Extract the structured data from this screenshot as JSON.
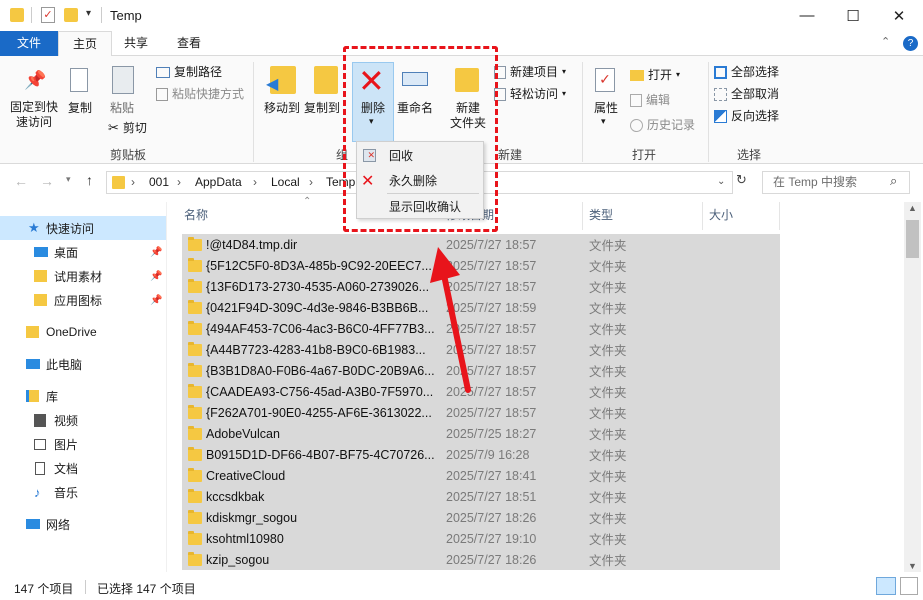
{
  "window": {
    "title": "Temp",
    "minimize": "—",
    "maximize": "☐",
    "close": "✕"
  },
  "ribbon_tabs": [
    "文件",
    "主页",
    "共享",
    "查看"
  ],
  "clipboard": {
    "pin": "固定到快\n速访问",
    "copy": "复制",
    "paste": "粘贴",
    "copy_path": "复制路径",
    "paste_shortcut": "粘贴快捷方式",
    "cut": "剪切",
    "group": "剪贴板"
  },
  "organize": {
    "move_to": "移动到",
    "copy_to": "复制到",
    "delete": "删除",
    "rename": "重命名",
    "group": "组织"
  },
  "new": {
    "new_folder": "新建\n文件夹",
    "new_item": "新建项目",
    "easy_access": "轻松访问",
    "group": "新建"
  },
  "open": {
    "properties": "属性",
    "open": "打开",
    "edit": "编辑",
    "history": "历史记录",
    "group": "打开"
  },
  "select": {
    "select_all": "全部选择",
    "select_none": "全部取消",
    "invert": "反向选择",
    "group": "选择"
  },
  "delete_menu": {
    "recycle": "回收",
    "permanent": "永久删除",
    "show_confirm": "显示回收确认"
  },
  "address": {
    "crumbs": [
      "001",
      "AppData",
      "Local",
      "Temp"
    ],
    "search_placeholder": "在 Temp 中搜索"
  },
  "sidebar": {
    "quick_access": "快速访问",
    "items": [
      "桌面",
      "试用素材",
      "应用图标"
    ],
    "onedrive": "OneDrive",
    "this_pc": "此电脑",
    "libraries": "库",
    "lib_items": [
      "视频",
      "图片",
      "文档",
      "音乐"
    ],
    "network": "网络"
  },
  "columns": {
    "name": "名称",
    "date": "修改日期",
    "type": "类型",
    "size": "大小"
  },
  "files": [
    {
      "name": "!@t4D84.tmp.dir",
      "date": "2025/7/27 18:57",
      "type": "文件夹"
    },
    {
      "name": "{5F12C5F0-8D3A-485b-9C92-20EEC7...",
      "date": "2025/7/27 18:57",
      "type": "文件夹"
    },
    {
      "name": "{13F6D173-2730-4535-A060-2739026...",
      "date": "2025/7/27 18:57",
      "type": "文件夹"
    },
    {
      "name": "{0421F94D-309C-4d3e-9846-B3BB6B...",
      "date": "2025/7/27 18:59",
      "type": "文件夹"
    },
    {
      "name": "{494AF453-7C06-4ac3-B6C0-4FF77B3...",
      "date": "2025/7/27 18:57",
      "type": "文件夹"
    },
    {
      "name": "{A44B7723-4283-41b8-B9C0-6B1983...",
      "date": "2025/7/27 18:57",
      "type": "文件夹"
    },
    {
      "name": "{B3B1D8A0-F0B6-4a67-B0DC-20B9A6...",
      "date": "2025/7/27 18:57",
      "type": "文件夹"
    },
    {
      "name": "{CAADEA93-C756-45ad-A3B0-7F5970...",
      "date": "2025/7/27 18:57",
      "type": "文件夹"
    },
    {
      "name": "{F262A701-90E0-4255-AF6E-3613022...",
      "date": "2025/7/27 18:57",
      "type": "文件夹"
    },
    {
      "name": "AdobeVulcan",
      "date": "2025/7/25 18:27",
      "type": "文件夹"
    },
    {
      "name": "B0915D1D-DF66-4B07-BF75-4C70726...",
      "date": "2025/7/9 16:28",
      "type": "文件夹"
    },
    {
      "name": "CreativeCloud",
      "date": "2025/7/27 18:41",
      "type": "文件夹"
    },
    {
      "name": "kccsdkbak",
      "date": "2025/7/27 18:51",
      "type": "文件夹"
    },
    {
      "name": "kdiskmgr_sogou",
      "date": "2025/7/27 18:26",
      "type": "文件夹"
    },
    {
      "name": "ksohtml10980",
      "date": "2025/7/27 19:10",
      "type": "文件夹"
    },
    {
      "name": "kzip_sogou",
      "date": "2025/7/27 18:26",
      "type": "文件夹"
    }
  ],
  "status": {
    "count": "147 个项目",
    "selected": "已选择 147 个项目"
  },
  "colors": {
    "accent": "#1a6ac7",
    "highlight": "#e8141b",
    "selection": "#d9d9d9",
    "nav_selected": "#cce8ff"
  }
}
